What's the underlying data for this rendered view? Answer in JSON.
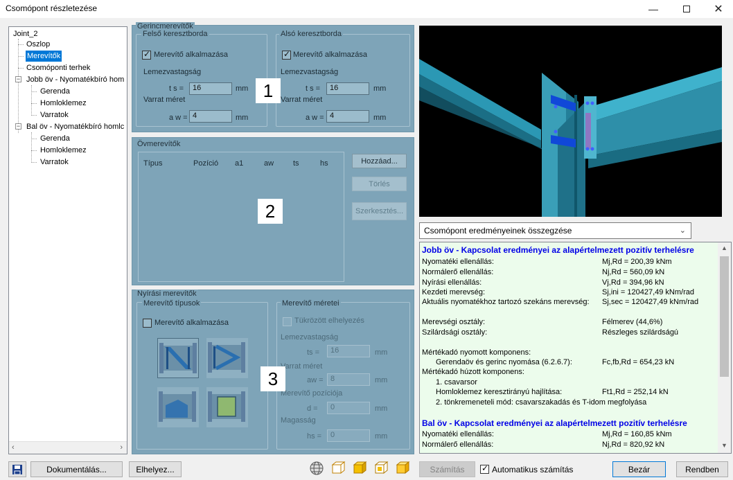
{
  "window": {
    "title": "Csomópont részletezése",
    "min_icon": "minimize-icon",
    "max_icon": "maximize-icon",
    "close_icon": "close-icon"
  },
  "tree": {
    "root": "Joint_2",
    "items": [
      {
        "label": "Oszlop"
      },
      {
        "label": "Merevítők",
        "selected": true
      },
      {
        "label": "Csomóponti terhek"
      },
      {
        "label": "Jobb öv - Nyomatékbíró hom"
      },
      {
        "label": "Gerenda"
      },
      {
        "label": "Homloklemez"
      },
      {
        "label": "Varratok"
      },
      {
        "label": "Bal öv - Nyomatékbíró homlc"
      },
      {
        "label": "Gerenda"
      },
      {
        "label": "Homloklemez"
      },
      {
        "label": "Varratok"
      }
    ]
  },
  "gerinc": {
    "title": "Gerincmerevítők",
    "felso": {
      "title": "Felső keresztborda",
      "chk": "Merevítő alkalmazása",
      "lemez": "Lemezvastagság",
      "ts_lbl": "t s =",
      "ts": "16",
      "unit": "mm",
      "varrat": "Varrat méret",
      "aw_lbl": "a w =",
      "aw": "4"
    },
    "also": {
      "title": "Alsó keresztborda",
      "chk": "Merevítő alkalmazása",
      "lemez": "Lemezvastagság",
      "ts_lbl": "t s =",
      "ts": "16",
      "unit": "mm",
      "varrat": "Varrat méret",
      "aw_lbl": "a w =",
      "aw": "4"
    },
    "badge": "1"
  },
  "ov": {
    "title": "Övmerevítők",
    "columns": [
      "Típus",
      "Pozíció",
      "a1",
      "aw",
      "ts",
      "hs"
    ],
    "add": "Hozzáad...",
    "del": "Törlés",
    "edit": "Szerkesztés...",
    "badge": "2"
  },
  "nyirasi": {
    "title": "Nyírási merevítők",
    "tipusok": "Merevítő típusok",
    "chk": "Merevítő alkalmazása",
    "meretei": "Merevítő méretei",
    "tukrozott": "Tükrözött elhelyezés",
    "lemez": "Lemezvastagság",
    "ts_lbl": "ts =",
    "ts": "16",
    "varrat": "Varrat méret",
    "aw_lbl": "aw =",
    "aw": "8",
    "pozicio": "Merevítő pozíciója",
    "d_lbl": "d =",
    "d": "0",
    "magassag": "Magasság",
    "hs_lbl": "hs =",
    "hs": "0",
    "unit": "mm",
    "badge": "3"
  },
  "combo": {
    "value": "Csomópont eredményeinek összegzése"
  },
  "results": {
    "h1": "Jobb öv - Kapcsolat eredményei az alapértelmezett pozitív terhelésre",
    "rows1": [
      [
        "Nyomatéki ellenállás:",
        "Mj,Rd = 200,39 kNm"
      ],
      [
        "Normálerő ellenállás:",
        "Nj,Rd = 560,09 kN"
      ],
      [
        "Nyírási ellenállás:",
        "Vj,Rd = 394,96 kN"
      ],
      [
        "Kezdeti merevség:",
        "Sj,ini = 120427,49 kNm/rad"
      ],
      [
        "Aktuális nyomatékhoz tartozó szekáns merevség:",
        "Sj,sec = 120427,49 kNm/rad"
      ]
    ],
    "merev_lbl": "Merevségi osztály:",
    "merev_val": "Félmerev (44,6%)",
    "szil_lbl": "Szilárdsági osztály:",
    "szil_val": "Részleges szilárdságú",
    "nyomott": "Mértékadó nyomott komponens:",
    "nyomott_row": [
      "Gerendaöv és gerinc nyomása (6.2.6.7):",
      "Fc,fb,Rd = 654,23 kN"
    ],
    "huzott": "Mértékadó húzott komponens:",
    "huzott_1": "1. csavarsor",
    "huzott_row": [
      "Homloklemez keresztirányú hajlítása:",
      "Ft1,Rd = 252,14 kN"
    ],
    "huzott_2": "2. tönkremeneteli mód: csavarszakadás és T-idom megfolyása",
    "h2": "Bal öv - Kapcsolat eredményei az alapértelmezett pozitív terhelésre",
    "rows2": [
      [
        "Nyomatéki ellenállás:",
        "Mj,Rd = 160,85 kNm"
      ],
      [
        "Normálerő ellenállás:",
        "Nj,Rd = 820,92 kN"
      ]
    ]
  },
  "bottom": {
    "doc": "Dokumentálás...",
    "place": "Elhelyez...",
    "calc": "Számítás",
    "auto": "Automatikus számítás",
    "close": "Bezár",
    "ok": "Rendben"
  }
}
